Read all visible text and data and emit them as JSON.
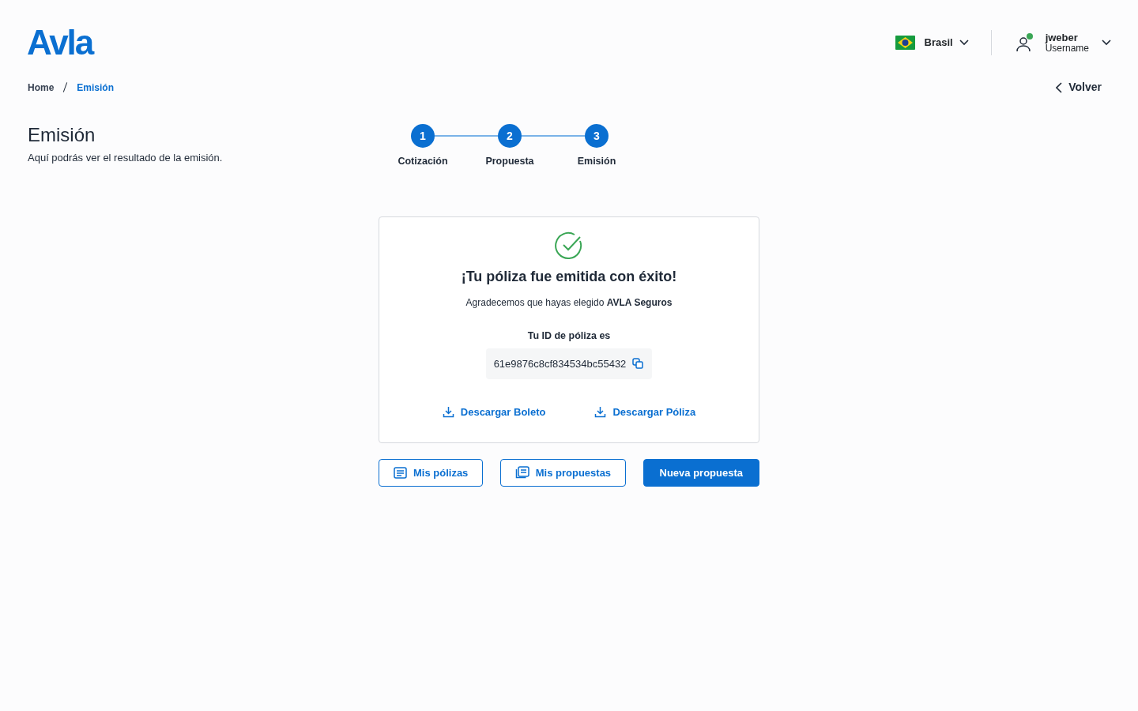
{
  "header": {
    "logo": "Avla",
    "country": {
      "label": "Brasil"
    },
    "user": {
      "name": "jweber",
      "role": "Username",
      "online": true
    }
  },
  "breadcrumb": [
    {
      "label": "Home",
      "current": false
    },
    {
      "label": "Emisión",
      "current": true
    }
  ],
  "back_link": "Volver",
  "page": {
    "title": "Emisión",
    "subtitle": "Aquí podrás ver el resultado de la emisión."
  },
  "steps": [
    {
      "number": "1",
      "label": "Cotización",
      "completed": true
    },
    {
      "number": "2",
      "label": "Propuesta",
      "completed": true
    },
    {
      "number": "3",
      "label": "Emisión",
      "completed": true
    }
  ],
  "result": {
    "title": "¡Tu póliza fue emitida con éxito!",
    "message": "Agradecemos que hayas elegido **AVLA Seguros**",
    "id_label": "Tu ID de póliza es",
    "policy_id": "61e9876c8cf834534bc55432",
    "downloads": [
      "Descargar Boleto",
      "Descargar Póliza"
    ]
  },
  "actions": [
    {
      "label": "Mis pólizas",
      "kind": "outline-single"
    },
    {
      "label": "Mis propuestas",
      "kind": "outline-stack"
    },
    {
      "label": "Nueva propuesta",
      "kind": "primary"
    }
  ]
}
